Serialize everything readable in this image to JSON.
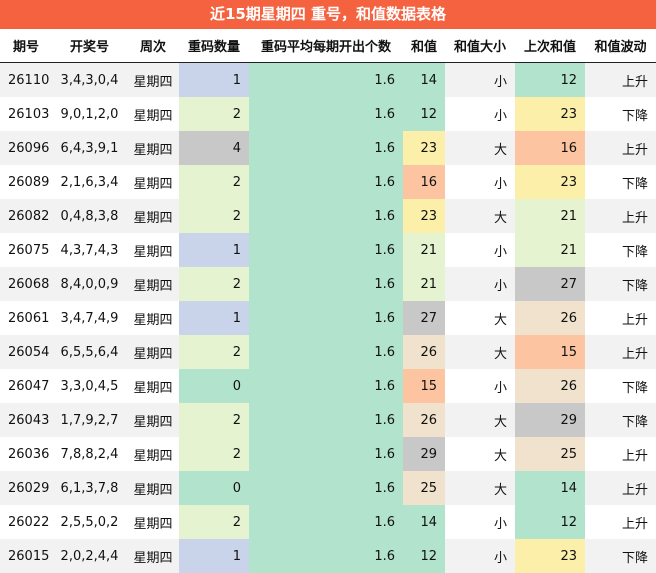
{
  "title": "近15期星期四 重号，和值数据表格",
  "headers": [
    "期号",
    "开奖号",
    "周次",
    "重码数量",
    "重码平均每期开出个数",
    "和值",
    "和值大小",
    "上次和值",
    "和值波动"
  ],
  "colors": {
    "title_bg": "#f4623f",
    "avg_bg": "#b2e3cd",
    "count_0": "#b2e3cd",
    "count_1": "#c9d4ea",
    "count_2": "#e6f3d1",
    "count_4": "#c8c8c8",
    "sum_12": "#b2e3cd",
    "sum_14": "#b2e3cd",
    "sum_15": "#fdc4a1",
    "sum_16": "#fdc4a1",
    "sum_21": "#e6f3d1",
    "sum_23": "#fbefaa",
    "sum_25": "#f0e2cc",
    "sum_26": "#f0e2cc",
    "sum_27": "#c8c8c8",
    "sum_29": "#c8c8c8"
  },
  "rows": [
    {
      "issue": "26110",
      "numbers": "3,4,3,0,4",
      "weekday": "星期四",
      "repeat": "1",
      "avg": "1.6",
      "sum": "14",
      "size": "小",
      "last_sum": "12",
      "trend": "上升"
    },
    {
      "issue": "26103",
      "numbers": "9,0,1,2,0",
      "weekday": "星期四",
      "repeat": "2",
      "avg": "1.6",
      "sum": "12",
      "size": "小",
      "last_sum": "23",
      "trend": "下降"
    },
    {
      "issue": "26096",
      "numbers": "6,4,3,9,1",
      "weekday": "星期四",
      "repeat": "4",
      "avg": "1.6",
      "sum": "23",
      "size": "大",
      "last_sum": "16",
      "trend": "上升"
    },
    {
      "issue": "26089",
      "numbers": "2,1,6,3,4",
      "weekday": "星期四",
      "repeat": "2",
      "avg": "1.6",
      "sum": "16",
      "size": "小",
      "last_sum": "23",
      "trend": "下降"
    },
    {
      "issue": "26082",
      "numbers": "0,4,8,3,8",
      "weekday": "星期四",
      "repeat": "2",
      "avg": "1.6",
      "sum": "23",
      "size": "大",
      "last_sum": "21",
      "trend": "上升"
    },
    {
      "issue": "26075",
      "numbers": "4,3,7,4,3",
      "weekday": "星期四",
      "repeat": "1",
      "avg": "1.6",
      "sum": "21",
      "size": "小",
      "last_sum": "21",
      "trend": "下降"
    },
    {
      "issue": "26068",
      "numbers": "8,4,0,0,9",
      "weekday": "星期四",
      "repeat": "2",
      "avg": "1.6",
      "sum": "21",
      "size": "小",
      "last_sum": "27",
      "trend": "下降"
    },
    {
      "issue": "26061",
      "numbers": "3,4,7,4,9",
      "weekday": "星期四",
      "repeat": "1",
      "avg": "1.6",
      "sum": "27",
      "size": "大",
      "last_sum": "26",
      "trend": "上升"
    },
    {
      "issue": "26054",
      "numbers": "6,5,5,6,4",
      "weekday": "星期四",
      "repeat": "2",
      "avg": "1.6",
      "sum": "26",
      "size": "大",
      "last_sum": "15",
      "trend": "上升"
    },
    {
      "issue": "26047",
      "numbers": "3,3,0,4,5",
      "weekday": "星期四",
      "repeat": "0",
      "avg": "1.6",
      "sum": "15",
      "size": "小",
      "last_sum": "26",
      "trend": "下降"
    },
    {
      "issue": "26043",
      "numbers": "1,7,9,2,7",
      "weekday": "星期四",
      "repeat": "2",
      "avg": "1.6",
      "sum": "26",
      "size": "大",
      "last_sum": "29",
      "trend": "下降"
    },
    {
      "issue": "26036",
      "numbers": "7,8,8,2,4",
      "weekday": "星期四",
      "repeat": "2",
      "avg": "1.6",
      "sum": "29",
      "size": "大",
      "last_sum": "25",
      "trend": "上升"
    },
    {
      "issue": "26029",
      "numbers": "6,1,3,7,8",
      "weekday": "星期四",
      "repeat": "0",
      "avg": "1.6",
      "sum": "25",
      "size": "大",
      "last_sum": "14",
      "trend": "上升"
    },
    {
      "issue": "26022",
      "numbers": "2,5,5,0,2",
      "weekday": "星期四",
      "repeat": "2",
      "avg": "1.6",
      "sum": "14",
      "size": "小",
      "last_sum": "12",
      "trend": "上升"
    },
    {
      "issue": "26015",
      "numbers": "2,0,2,4,4",
      "weekday": "星期四",
      "repeat": "1",
      "avg": "1.6",
      "sum": "12",
      "size": "小",
      "last_sum": "23",
      "trend": "下降"
    }
  ]
}
